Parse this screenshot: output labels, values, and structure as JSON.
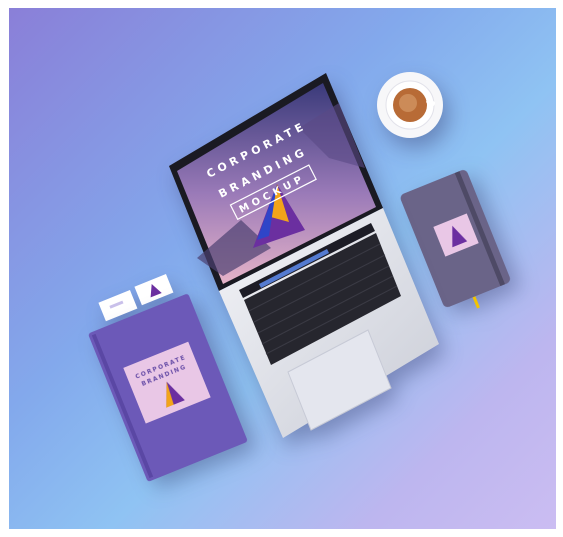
{
  "scene": {
    "laptop_screen": {
      "line1": "CORPORATE",
      "line2": "BRANDING",
      "line3": "MOCKUP"
    },
    "book_cover": {
      "line1": "CORPORATE",
      "line2": "BRANDING"
    },
    "colors": {
      "background_top_left": "#8a7fd8",
      "background_bottom_right": "#cbbdf2",
      "book": "#6c59b8",
      "notebook": "#6a6488",
      "logo_purple": "#6b2fa0",
      "logo_orange": "#f2a41a",
      "logo_blue": "#2f45c8"
    }
  }
}
